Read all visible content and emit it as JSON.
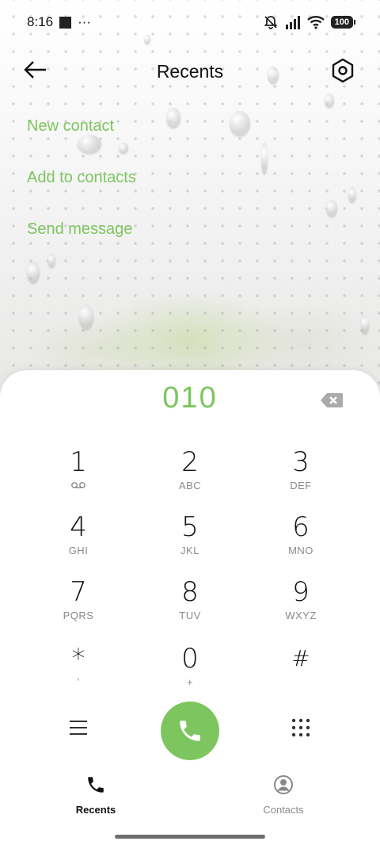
{
  "status_bar": {
    "time": "8:16",
    "overflow": "···",
    "battery": "100",
    "icons": [
      "notification-square-icon",
      "mute-icon",
      "signal-icon",
      "wifi-icon",
      "battery-icon"
    ]
  },
  "app_bar": {
    "title": "Recents",
    "back_icon": "back-arrow-icon",
    "settings_icon": "settings-hexagon-icon"
  },
  "options": [
    {
      "label": "New contact"
    },
    {
      "label": "Add to contacts"
    },
    {
      "label": "Send message"
    }
  ],
  "dialer": {
    "number": "010",
    "keys": [
      {
        "digit": "1",
        "letters": ""
      },
      {
        "digit": "2",
        "letters": "ABC"
      },
      {
        "digit": "3",
        "letters": "DEF"
      },
      {
        "digit": "4",
        "letters": "GHI"
      },
      {
        "digit": "5",
        "letters": "JKL"
      },
      {
        "digit": "6",
        "letters": "MNO"
      },
      {
        "digit": "7",
        "letters": "PQRS"
      },
      {
        "digit": "8",
        "letters": "TUV"
      },
      {
        "digit": "9",
        "letters": "WXYZ"
      },
      {
        "digit": "*",
        "letters": ","
      },
      {
        "digit": "0",
        "letters": "+"
      },
      {
        "digit": "#",
        "letters": ""
      }
    ]
  },
  "nav": {
    "recents": "Recents",
    "contacts": "Contacts"
  },
  "colors": {
    "accent": "#7dc55f",
    "text": "#111111",
    "muted": "#8a8a8a"
  }
}
